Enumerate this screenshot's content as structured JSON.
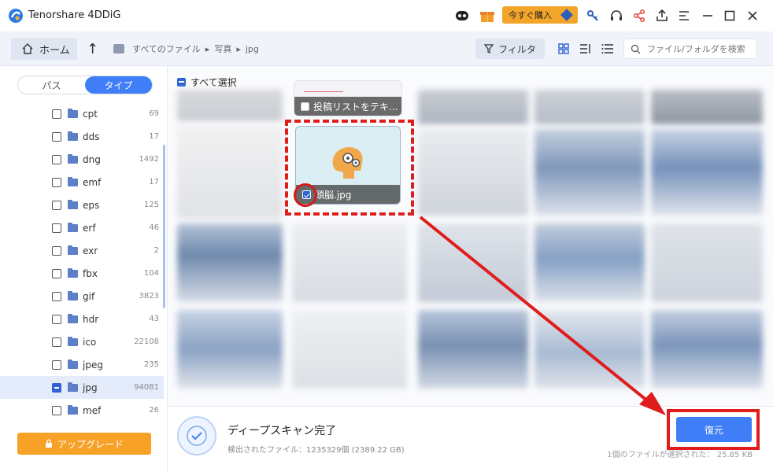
{
  "app": {
    "title": "Tenorshare 4DDiG"
  },
  "titlebar": {
    "buy_label": "今すぐ購入",
    "icons": [
      "robot-icon",
      "gift-icon",
      "key-icon",
      "headset-icon",
      "share-icon",
      "export-icon",
      "menu-icon",
      "minimize-icon",
      "maximize-icon",
      "close-icon"
    ]
  },
  "nav": {
    "home_label": "ホーム",
    "breadcrumb": [
      "すべてのファイル",
      "写真",
      "jpg"
    ],
    "filter_label": "フィルタ",
    "search_placeholder": "ファイル/フォルダを検索"
  },
  "sidebar": {
    "tabs": [
      "パス",
      "タイプ"
    ],
    "active_tab": "タイプ",
    "types": [
      {
        "name": "cpt",
        "count": "69"
      },
      {
        "name": "dds",
        "count": "17"
      },
      {
        "name": "dng",
        "count": "1492"
      },
      {
        "name": "emf",
        "count": "17"
      },
      {
        "name": "eps",
        "count": "125"
      },
      {
        "name": "erf",
        "count": "46"
      },
      {
        "name": "exr",
        "count": "2"
      },
      {
        "name": "fbx",
        "count": "104"
      },
      {
        "name": "gif",
        "count": "3823"
      },
      {
        "name": "hdr",
        "count": "43"
      },
      {
        "name": "ico",
        "count": "22108"
      },
      {
        "name": "jpeg",
        "count": "235"
      },
      {
        "name": "jpg",
        "count": "94081"
      },
      {
        "name": "mef",
        "count": "26"
      }
    ],
    "selected_type": "jpg",
    "upgrade_label": "アップグレード"
  },
  "main": {
    "select_all_label": "すべて選択",
    "top_tile_caption": "投稿リストをテキ...",
    "selected_file_caption": "頭脳.jpg"
  },
  "status": {
    "title": "ディープスキャン完了",
    "found": "検出されたファイル：1235329個 (2389.22 GB)",
    "recover_label": "復元",
    "selection_info": "1個のファイルが選択された： 25.85 KB"
  },
  "colors": {
    "accent": "#3f7ef7",
    "upgrade": "#f7a127",
    "annotation": "#e01d1d"
  }
}
